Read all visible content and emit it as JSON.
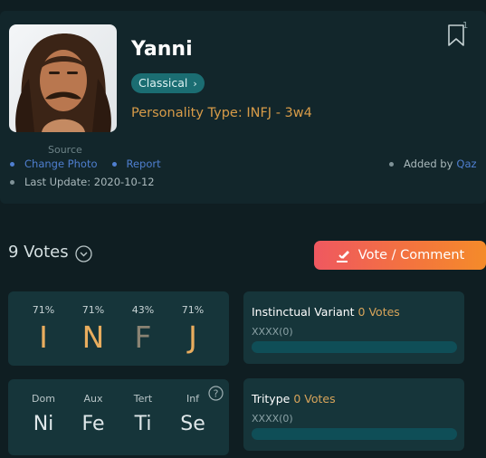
{
  "profile": {
    "name": "Yanni",
    "category_tag": "Classical",
    "personality_type": "Personality Type: INFJ - 3w4",
    "bookmark_count": "1",
    "source_label": "Source",
    "change_photo": "Change Photo",
    "report": "Report",
    "last_update": "Last Update: 2020-10-12",
    "added_by_label": "Added by",
    "added_by_user": "Qaz"
  },
  "votes": {
    "title": "9 Votes",
    "vote_button": "Vote / Comment"
  },
  "mbti": {
    "percents": [
      "71%",
      "71%",
      "43%",
      "71%"
    ],
    "letters": [
      "I",
      "N",
      "F",
      "J"
    ]
  },
  "functions": {
    "labels": [
      "Dom",
      "Aux",
      "Tert",
      "Inf"
    ],
    "values": [
      "Ni",
      "Fe",
      "Ti",
      "Se"
    ]
  },
  "instinctual": {
    "title": "Instinctual Variant",
    "count": "0 Votes",
    "placeholder": "XXXX(0)"
  },
  "tritype": {
    "title": "Tritype",
    "count": "0 Votes",
    "placeholder": "XXXX(0)"
  },
  "colors": {
    "accent_orange": "#d79b48",
    "tag_teal": "#1b6d72",
    "link_blue": "#4f7fd0",
    "button_gradient_start": "#ef5860",
    "button_gradient_end": "#f48b2a"
  },
  "icons": [
    "bookmark-icon",
    "chevron-down-icon",
    "gavel-icon",
    "help-icon",
    "chevron-right-icon"
  ]
}
